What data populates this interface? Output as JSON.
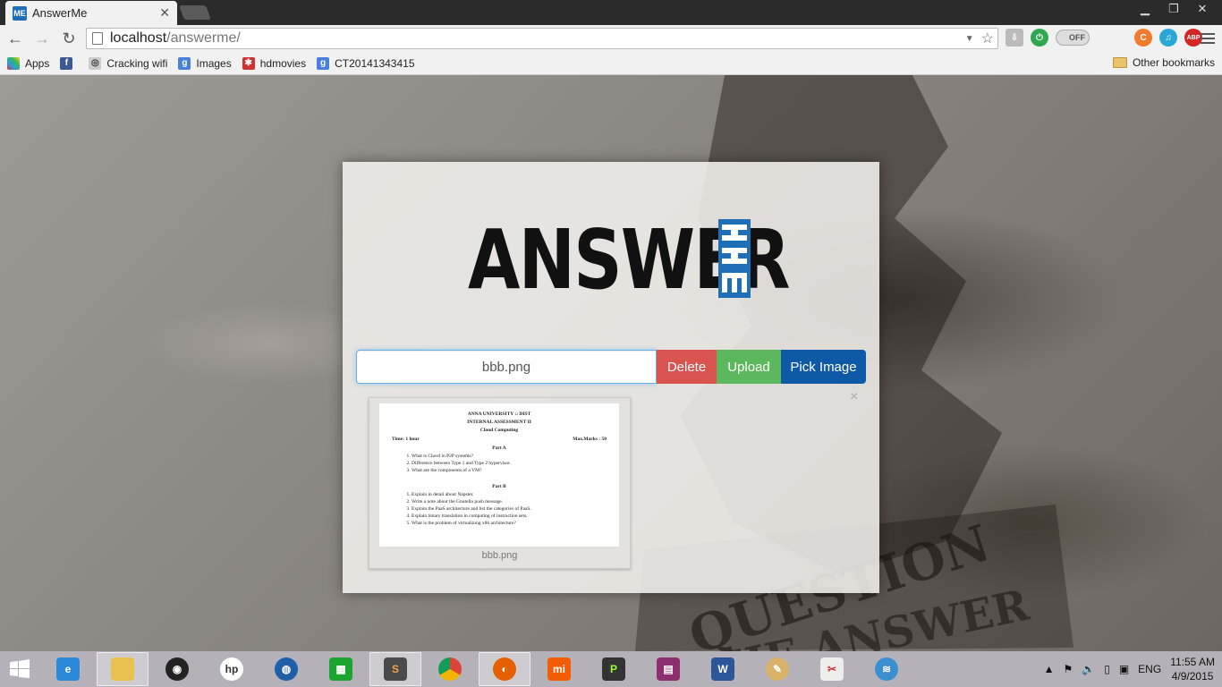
{
  "browser": {
    "tab_title": "AnswerMe",
    "favicon_text": "ME",
    "url_host": "localhost",
    "url_path": "/answerme/",
    "toggle_label": "OFF",
    "abp_label": "ABP"
  },
  "bookmarks": {
    "items": [
      {
        "label": "Apps",
        "icon": "apps-grid-icon"
      },
      {
        "label": "",
        "icon": "facebook-icon"
      },
      {
        "label": "Cracking wifi",
        "icon": "wifi-bookmark-icon"
      },
      {
        "label": "Images",
        "icon": "google-icon"
      },
      {
        "label": "hdmovies",
        "icon": "hdmovies-icon"
      },
      {
        "label": "CT20141343415",
        "icon": "google-icon"
      }
    ],
    "other": "Other bookmarks"
  },
  "page": {
    "logo_text": "ANSWER",
    "file_value": "bbb.png",
    "delete_label": "Delete",
    "upload_label": "Upload",
    "pick_label": "Pick Image",
    "close_label": "×",
    "thumb_caption": "bbb.png",
    "doc": {
      "university": "ANNA UNIVERSITY :: DIST",
      "assessment": "INTERNAL ASSESSMENT II",
      "subject": "Cloud Computing",
      "time": "Time: 1 hour",
      "marks": "Max.Marks : 50",
      "part_a": "Part A",
      "part_a_items": [
        "What is Chord in P2P systems?",
        "Difference between Type 1 and Type 2 hypervisor.",
        "What are the components of a VM?"
      ],
      "part_b": "Part B",
      "part_b_items": [
        "Explain in detail about Napster.",
        "Write a note about the Gnutella push message.",
        "Explain the PaaS architecture and list the categories of PaaS.",
        "Explain binary translation in computing of instruction sets.",
        "What is the problem of virtualizing x86 architecture?"
      ]
    }
  },
  "taskbar": {
    "language": "ENG",
    "time": "11:55 AM",
    "date": "4/9/2015"
  },
  "colors": {
    "delete": "#d9534f",
    "upload": "#5cb85c",
    "pick": "#0f5aa6",
    "brand_blue": "#1e6fb8"
  }
}
